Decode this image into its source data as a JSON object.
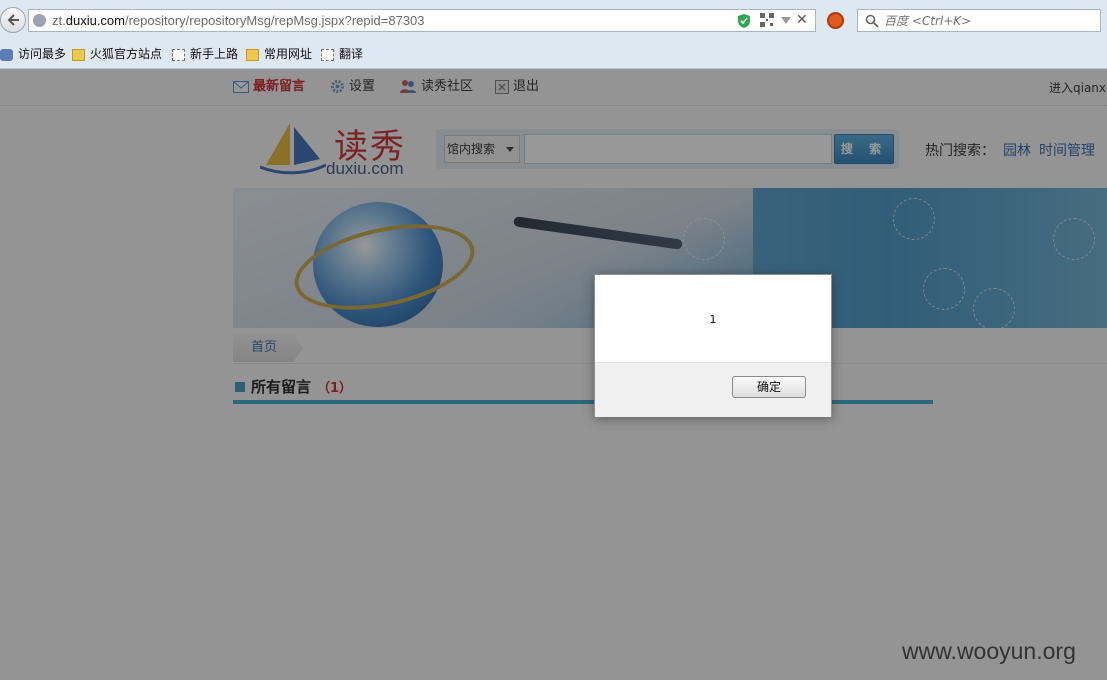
{
  "browser": {
    "url_prefix": "zt.",
    "url_domain": "duxiu.com",
    "url_path": "/repository/repositoryMsg/repMsg.jspx?repid=87303",
    "search_placeholder": "百度 <Ctrl+K>",
    "bookmarks": [
      "访问最多",
      "火狐官方站点",
      "新手上路",
      "常用网址",
      "翻译"
    ]
  },
  "site": {
    "nav": {
      "latest": "最新留言",
      "settings": "设置",
      "community": "读秀社区",
      "logout": "退出",
      "login_text": "进入qianxi"
    },
    "logo": {
      "cn": "读秀",
      "en": "duxiu.com"
    },
    "search": {
      "scope": "馆内搜索",
      "button": "搜 索",
      "hot_label": "热门搜索：",
      "hot_keywords": [
        "园林",
        "时间管理"
      ]
    },
    "breadcrumb": "首页",
    "section": {
      "title": "所有留言",
      "count": "（1）"
    }
  },
  "dialog": {
    "message": "1",
    "ok_label": "确定"
  },
  "watermark": "www.wooyun.org",
  "colors": {
    "accent_red": "#c8171e",
    "link_blue": "#1f5fa8",
    "section_bar": "#2da3cc"
  }
}
